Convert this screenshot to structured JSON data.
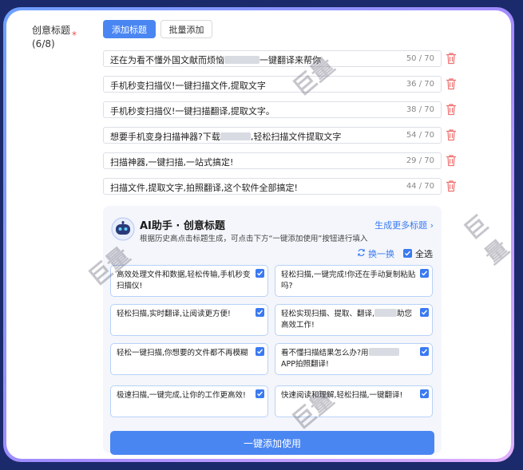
{
  "form": {
    "label": "创意标题",
    "required_mark": "*",
    "count": "(6/8)",
    "add_title_button": "添加标题",
    "batch_add_button": "批量添加"
  },
  "titles": [
    {
      "pre": "还在为看不懂外国文献而烦恼",
      "post": "一键翻译来帮你",
      "length": "50 / 70"
    },
    {
      "pre": "手机秒变扫描仪!一键扫描文件,提取文字",
      "post": "",
      "length": "36 / 70"
    },
    {
      "pre": "手机秒变扫描仪!一键扫描翻译,提取文字。",
      "post": "",
      "length": "38 / 70"
    },
    {
      "pre": "想要手机变身扫描神器?下载",
      "post": ",轻松扫描文件提取文字",
      "length": "54 / 70"
    },
    {
      "pre": "扫描神器,一键扫描,一站式搞定!",
      "post": "",
      "length": "29 / 70"
    },
    {
      "pre": "扫描文件,提取文字,拍照翻译,这个软件全部搞定!",
      "post": "",
      "length": "44 / 70"
    }
  ],
  "ai": {
    "title": "AI助手 · 创意标题",
    "description": "根据历史高点击标题生成，可点击下方“一键添加使用”按钮进行填入",
    "more_link": "生成更多标题 ›",
    "refresh": "换一换",
    "select_all": "全选",
    "add_all_button": "一键添加使用",
    "accent_color": "#4a86f2",
    "suggestions": [
      {
        "pre": "高效处理文件和数据,轻松传输,手机秒变扫描仪!",
        "post": ""
      },
      {
        "pre": "轻松扫描,一键完成!你还在手动复制粘贴吗?",
        "post": ""
      },
      {
        "pre": "轻松扫描,实时翻译,让阅读更方便!",
        "post": ""
      },
      {
        "pre": "轻松实现扫描、提取、翻译,",
        "post": "助您高效工作!"
      },
      {
        "pre": "轻松一键扫描,你想要的文件都不再模糊",
        "post": ""
      },
      {
        "pre": "看不懂扫描结果怎么办?用",
        "post": "APP拍照翻译!"
      },
      {
        "pre": "极速扫描,一键完成,让你的工作更高效!",
        "post": ""
      },
      {
        "pre": "快速阅读和理解,轻松扫描,一键翻译!",
        "post": ""
      }
    ]
  },
  "watermark": "巨量"
}
